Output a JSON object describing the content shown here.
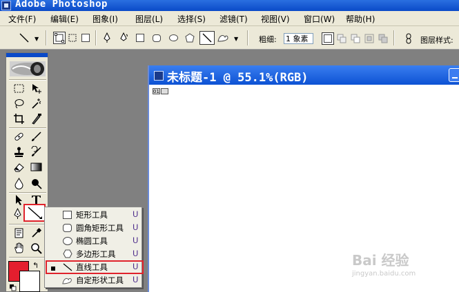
{
  "app": {
    "title": "Adobe Photoshop"
  },
  "menu": [
    {
      "label": "文件(F)"
    },
    {
      "label": "编辑(E)"
    },
    {
      "label": "图象(I)"
    },
    {
      "label": "图层(L)"
    },
    {
      "label": "选择(S)"
    },
    {
      "label": "滤镜(T)"
    },
    {
      "label": "视图(V)"
    },
    {
      "label": "窗口(W)"
    },
    {
      "label": "帮助(H)"
    }
  ],
  "options_bar": {
    "weight_label": "粗细:",
    "weight_value": "1 象素",
    "layer_style_label": "图层样式:"
  },
  "document": {
    "title": "未标题-1 @ 55.1%(RGB)",
    "ruler_label": "01"
  },
  "flyout": {
    "items": [
      {
        "label": "矩形工具",
        "shortcut": "U",
        "icon": "rectangle-icon",
        "selected": false
      },
      {
        "label": "圆角矩形工具",
        "shortcut": "U",
        "icon": "rounded-rectangle-icon",
        "selected": false
      },
      {
        "label": "椭圆工具",
        "shortcut": "U",
        "icon": "ellipse-icon",
        "selected": false
      },
      {
        "label": "多边形工具",
        "shortcut": "U",
        "icon": "polygon-icon",
        "selected": false
      },
      {
        "label": "直线工具",
        "shortcut": "U",
        "icon": "line-icon",
        "selected": true
      },
      {
        "label": "自定形状工具",
        "shortcut": "U",
        "icon": "custom-shape-icon",
        "selected": false
      }
    ]
  },
  "colors": {
    "foreground": "#e41e2e",
    "background": "#ffffff",
    "highlight": "#e0222b",
    "titlebar": "#0a4ac8"
  },
  "watermark": {
    "main": "Bai 经验",
    "sub": "jingyan.baidu.com"
  }
}
